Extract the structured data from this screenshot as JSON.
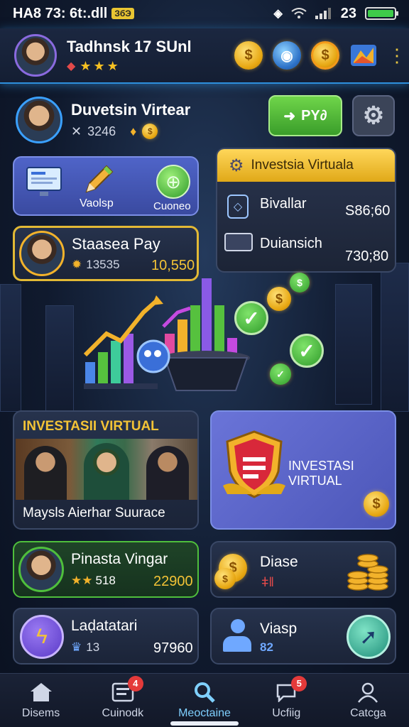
{
  "status_bar": {
    "left_text": "HA8 73: 6t:.dll",
    "badge": "ЗбЭ",
    "right_text": "23"
  },
  "header": {
    "name": "Tadhnsk 17 SUnl",
    "stars": "★★★"
  },
  "profile": {
    "name": "Duvetsin Virtear",
    "stat": "3246",
    "action_label": "PY∂"
  },
  "tools_card": {
    "left_label": "Vaolsp",
    "right_label": "Cuoneo"
  },
  "invest_panel": {
    "title": "Investsia Virtuala",
    "rows": [
      {
        "label": "Bivallar",
        "value": "S86;60"
      },
      {
        "label": "Duiansich",
        "value": "730;80"
      }
    ]
  },
  "pay_card": {
    "name": "Staasea Pay",
    "stat": "13535",
    "value": "10,550"
  },
  "team_card": {
    "title": "INVESTASII VIRTUAL",
    "caption": "Maysls Aierhar Suurace"
  },
  "shield_card": {
    "title": "INVESTASI VIRTUAL"
  },
  "small_cards": [
    {
      "name": "Pinasta Vingar",
      "stat": "518",
      "value": "22900"
    },
    {
      "name": "Diase",
      "stat": ""
    },
    {
      "name": "Laḍatatari",
      "stat": "13",
      "value": "97960"
    },
    {
      "name": "Viasp",
      "stat": "82"
    }
  ],
  "nav": [
    {
      "label": "Disems",
      "badge": ""
    },
    {
      "label": "Cuinodk",
      "badge": "4"
    },
    {
      "label": "Meoctaine",
      "badge": ""
    },
    {
      "label": "Ucfiig",
      "badge": "5"
    },
    {
      "label": "Catcga",
      "badge": ""
    }
  ]
}
